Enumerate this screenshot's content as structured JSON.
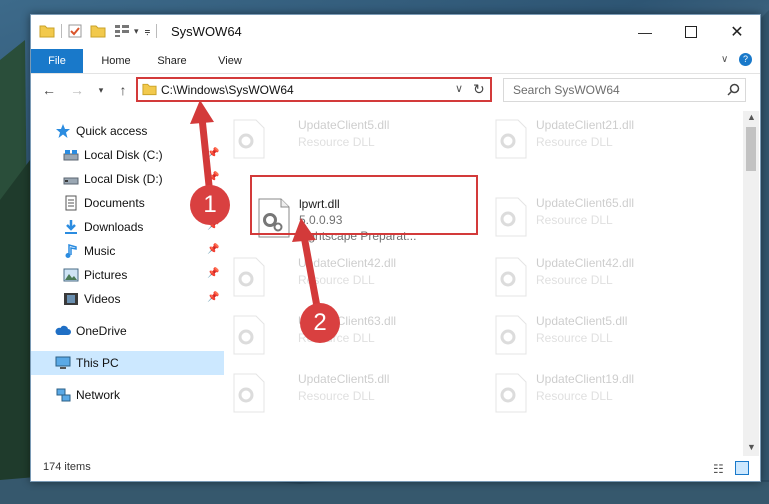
{
  "window": {
    "title": "SysWOW64",
    "quick_access_toolbar": [
      "folder-icon",
      "properties-icon",
      "new-folder-icon",
      "customize-icon"
    ]
  },
  "ribbon": {
    "tabs": [
      "File",
      "Home",
      "Share",
      "View"
    ]
  },
  "address_bar": {
    "path": "C:\\Windows\\SysWOW64"
  },
  "search": {
    "placeholder": "Search SysWOW64"
  },
  "sidebar": {
    "items": [
      {
        "label": "Quick access",
        "icon": "star-icon",
        "pinned": false
      },
      {
        "label": "Local Disk (C:)",
        "icon": "drive-icon",
        "pinned": true
      },
      {
        "label": "Local Disk (D:)",
        "icon": "drive-icon",
        "pinned": true
      },
      {
        "label": "Documents",
        "icon": "document-icon",
        "pinned": true
      },
      {
        "label": "Downloads",
        "icon": "download-icon",
        "pinned": true
      },
      {
        "label": "Music",
        "icon": "music-icon",
        "pinned": true
      },
      {
        "label": "Pictures",
        "icon": "pictures-icon",
        "pinned": true
      },
      {
        "label": "Videos",
        "icon": "video-icon",
        "pinned": true
      },
      {
        "label": "OneDrive",
        "icon": "cloud-icon",
        "pinned": false
      },
      {
        "label": "This PC",
        "icon": "computer-icon",
        "pinned": false,
        "selected": true
      },
      {
        "label": "Network",
        "icon": "network-icon",
        "pinned": false
      }
    ]
  },
  "files": {
    "highlighted": {
      "name": "lpwrt.dll",
      "version": "5.0.0.93",
      "description": "Lightscape Preparat..."
    },
    "col1": [
      {
        "name": "UpdateClient5.dll",
        "type": "Resource DLL"
      },
      {
        "name": "UpdateClient42.dll",
        "type": "Resource DLL"
      },
      {
        "name": "UpdateClient63.dll",
        "type": "Resource DLL"
      },
      {
        "name": "UpdateClient5.dll",
        "type": "Resource DLL"
      }
    ],
    "col2": [
      {
        "name": "UpdateClient21.dll",
        "type": "Resource DLL"
      },
      {
        "name": "UpdateClient65.dll",
        "type": "Resource DLL"
      },
      {
        "name": "UpdateClient42.dll",
        "type": "Resource DLL"
      },
      {
        "name": "UpdateClient5.dll",
        "type": "Resource DLL"
      },
      {
        "name": "UpdateClient19.dll",
        "type": "Resource DLL"
      }
    ]
  },
  "status": {
    "item_count": "174 items"
  },
  "annotations": {
    "step1": "1",
    "step2": "2",
    "accent": "#d33a3a"
  }
}
